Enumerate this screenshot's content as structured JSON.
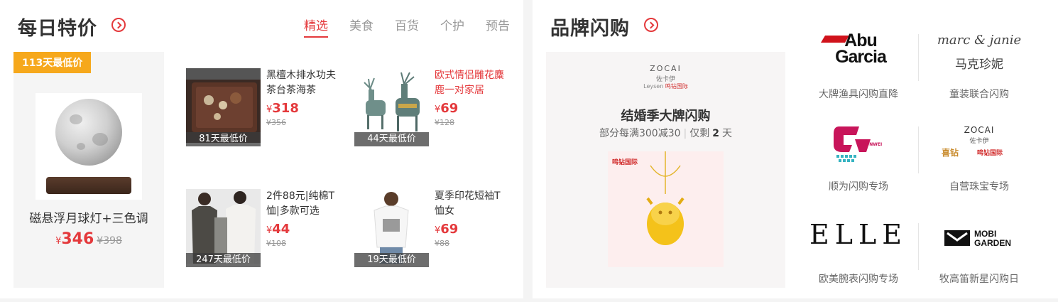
{
  "daily": {
    "title": "每日特价",
    "tabs": [
      "精选",
      "美食",
      "百货",
      "个护",
      "预告"
    ],
    "featured": {
      "badge": "113天最低价",
      "name": "磁悬浮月球灯+三色调",
      "currency": "¥",
      "price": "346",
      "old_price": "¥398"
    },
    "items": [
      {
        "name": "黑檀木排水功夫茶台茶海茶",
        "currency": "¥",
        "price": "318",
        "old_price": "¥356",
        "badge": "81天最低价"
      },
      {
        "name": "欧式情侣雕花麋鹿一对家居",
        "currency": "¥",
        "price": "69",
        "old_price": "¥128",
        "badge": "44天最低价"
      },
      {
        "name": "2件88元|纯棉T恤|多款可选",
        "currency": "¥",
        "price": "44",
        "old_price": "¥108",
        "badge": "247天最低价"
      },
      {
        "name": "夏季印花短袖T恤女",
        "currency": "¥",
        "price": "69",
        "old_price": "¥88",
        "badge": "19天最低价"
      }
    ]
  },
  "brand": {
    "title": "品牌闪购",
    "main": {
      "logo_text": "ZOCAI",
      "logo_cn": "佐卡伊",
      "logo_sub1": "Leysen",
      "logo_sub2": "鸣钻国际",
      "title": "结婚季大牌闪购",
      "sub_left": "部分每满300减30",
      "sub_mid": "仅剩",
      "sub_days": "2",
      "sub_right": "天",
      "img_label": "鸣钻国际"
    },
    "cells": [
      {
        "logo": "Abu Garcia",
        "name": "大牌渔具闪购直降"
      },
      {
        "logo": "marc & janie",
        "logo_cn": "马克珍妮",
        "name": "童装联合闪购"
      },
      {
        "logo": "SHUNWEI",
        "name": "顺为闪购专场"
      },
      {
        "logo": "ZOCAI",
        "logo_cn": "佐卡伊",
        "logo_sub1": "喜钻",
        "logo_sub2": "鸣钻国际",
        "name": "自营珠宝专场"
      },
      {
        "logo": "ELLE",
        "name": "欧美腕表闪购专场"
      },
      {
        "logo": "MOBI GARDEN",
        "name": "牧高笛新星闪购日"
      }
    ]
  }
}
